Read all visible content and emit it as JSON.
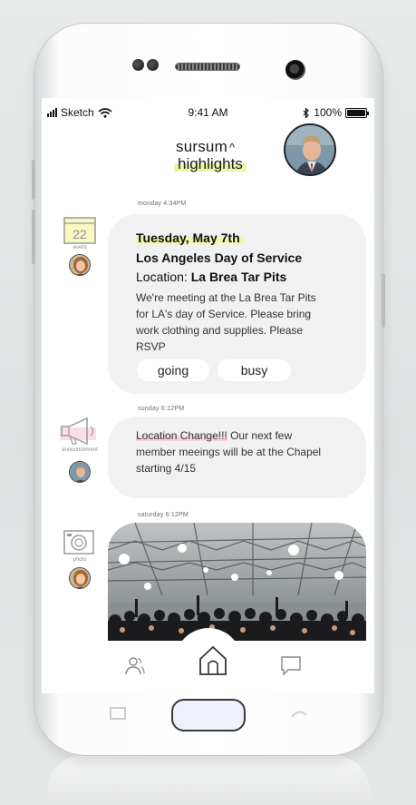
{
  "status_bar": {
    "carrier": "Sketch",
    "time": "9:41 AM",
    "battery": "100%",
    "battery_level": 1.0
  },
  "header": {
    "app_name": "sursum",
    "caret": "^",
    "subtitle": "highlights"
  },
  "feed": [
    {
      "timestamp": "monday 4:34PM",
      "type_label": "event",
      "icon": "calendar-icon",
      "calendar_day": "22",
      "date": "Tuesday, May 7th",
      "title": "Los Angeles Day of Service",
      "location_label": "Location:",
      "location": "La Brea Tar Pits",
      "body": "We're meeting at the La Brea Tar Pits for LA's day of Service. Please bring work clothing and supplies. Please RSVP",
      "actions": [
        "going",
        "busy"
      ]
    },
    {
      "timestamp": "sunday 6:12PM",
      "type_label": "announcement",
      "icon": "megaphone-icon",
      "body_highlight": "Location Change!!!",
      "body": " Our next few member meeings will be at the Chapel starting 4/15"
    },
    {
      "timestamp": "saturday 6:12PM",
      "type_label": "photo",
      "icon": "camera-icon"
    }
  ],
  "tabbar": {
    "items": [
      "people-icon",
      "home-icon",
      "chat-icon"
    ]
  },
  "colors": {
    "accent_yellow": "#e9f6a8",
    "accent_pink": "#f7d4e3",
    "card": "#f1f1f1"
  }
}
